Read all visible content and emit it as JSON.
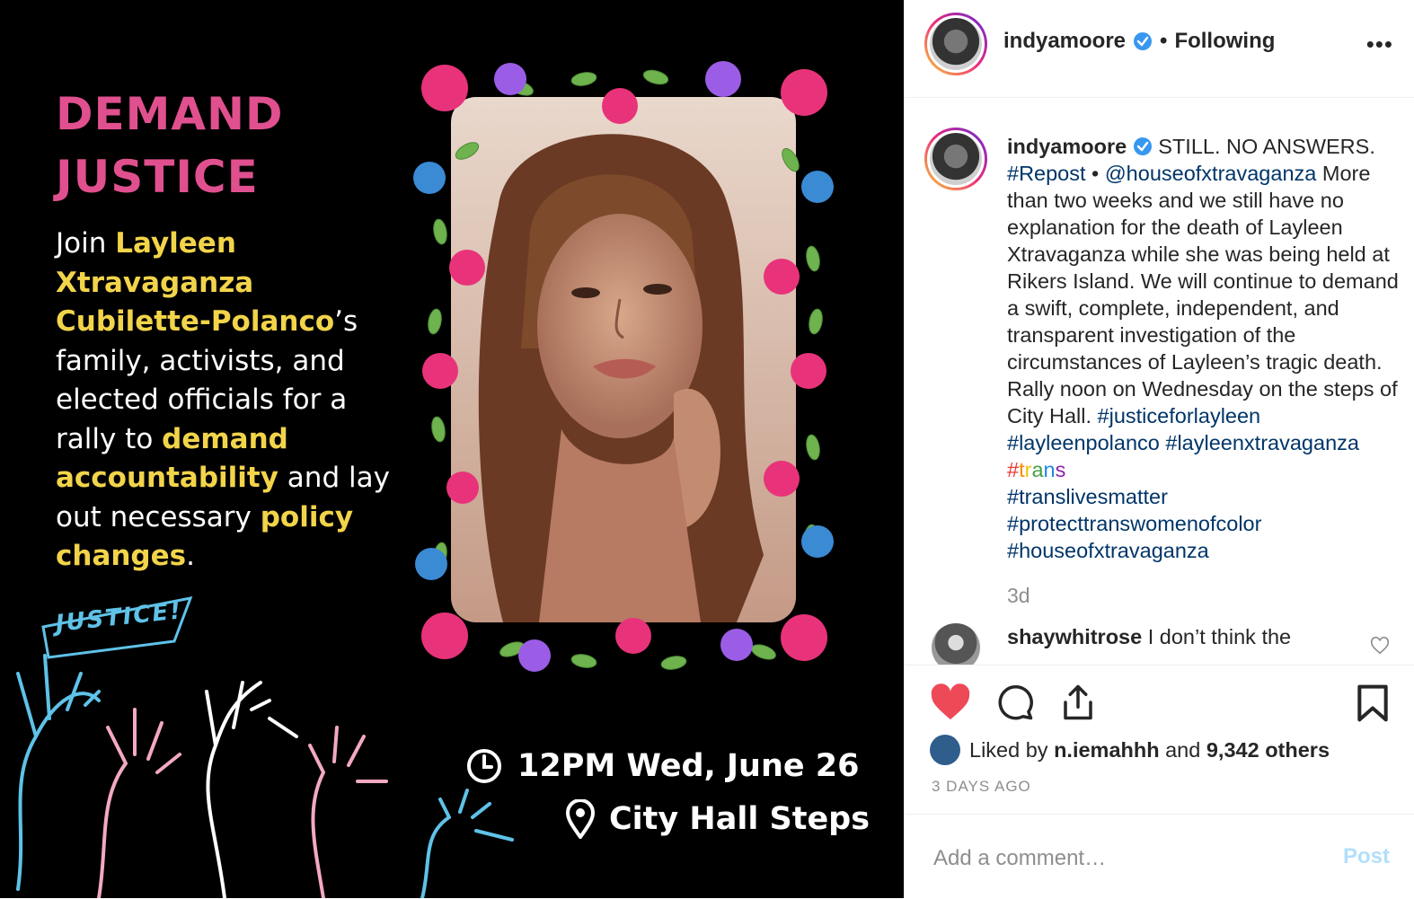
{
  "colors": {
    "headline_pink": "#e0508f",
    "highlight_yellow": "#f2d44a",
    "link_blue": "#003569",
    "like_red": "#ed4956",
    "verified_blue": "#3897f0",
    "post_button_disabled": "#b2dffc"
  },
  "post_image": {
    "headline_line1": "DEMAND",
    "headline_line2": "JUSTICE",
    "body": {
      "p1": "Join ",
      "name1": "Layleen",
      "name2": "Xtravaganza",
      "name3": "Cubilette-Polanco",
      "p2": "’s family, activists, and elected officials for a rally to ",
      "hl1": "demand",
      "hl2": "accountability",
      "p3": " and lay out necessary ",
      "hl3": "policy changes",
      "p4": "."
    },
    "flag_text": "JUSTICE!",
    "event_time": "12PM Wed, June 26",
    "event_place": "City Hall Steps",
    "clock_icon": "clock-icon",
    "pin_icon": "location-pin-icon"
  },
  "header": {
    "username": "indyamoore",
    "separator": "•",
    "follow_status": "Following",
    "more": "•••"
  },
  "caption": {
    "username": "indyamoore",
    "lead": " STILL. NO ANSWERS.",
    "repost_tag": "#Repost",
    "bullet": " • ",
    "mention": "@houseofxtravaganza",
    "text": " More than two weeks and we still have no explanation for the death of Layleen Xtravaganza while she was being held at Rikers Island. We will continue to demand a swift, complete, independent, and transparent investigation of the circumstances of Layleen’s tragic death. Rally noon on Wednesday on the steps of City Hall.",
    "tags": [
      "#justiceforlayleen",
      "#layleenpolanco",
      "#layleenxtravaganza"
    ],
    "rainbow_tag": [
      "#",
      "t",
      "r",
      "a",
      "n",
      "s"
    ],
    "tags2": [
      "#translivesmatter",
      "#protecttranswomenofcolor",
      "#houseofxtravaganza"
    ],
    "age": "3d"
  },
  "comment": {
    "username": "shaywhitrose",
    "text": " I don’t think the"
  },
  "likes": {
    "prefix": "Liked by ",
    "user": "n.iemahhh",
    "middle": " and ",
    "count": "9,342 others"
  },
  "posted_ago": "3 DAYS AGO",
  "comment_box": {
    "placeholder": "Add a comment…",
    "post_label": "Post"
  }
}
